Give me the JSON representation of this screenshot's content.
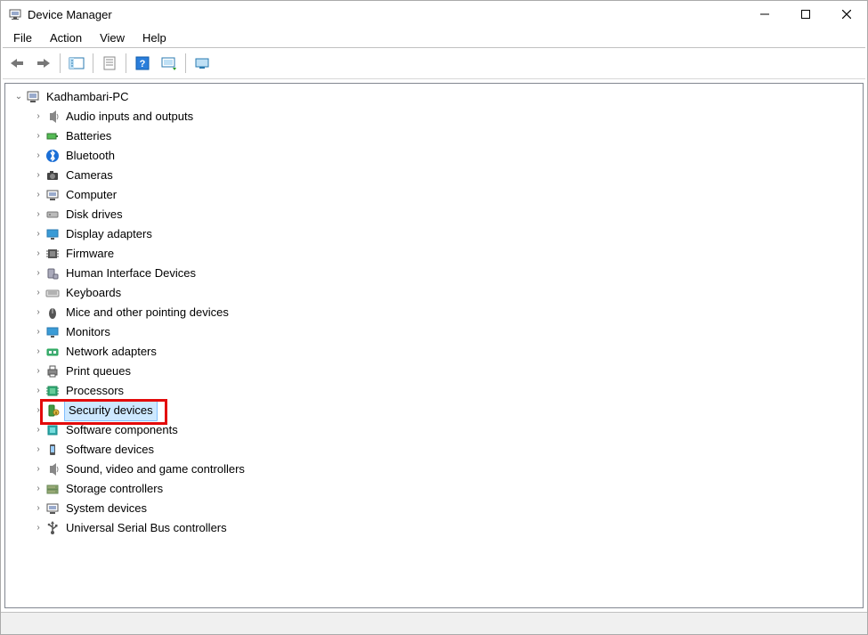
{
  "window": {
    "title": "Device Manager"
  },
  "menu": {
    "file": "File",
    "action": "Action",
    "view": "View",
    "help": "Help"
  },
  "tree": {
    "root": {
      "label": "Kadhambari-PC",
      "expanded": true
    },
    "items": [
      {
        "id": "audio",
        "label": "Audio inputs and outputs"
      },
      {
        "id": "batteries",
        "label": "Batteries"
      },
      {
        "id": "bluetooth",
        "label": "Bluetooth"
      },
      {
        "id": "cameras",
        "label": "Cameras"
      },
      {
        "id": "computer",
        "label": "Computer"
      },
      {
        "id": "diskdrives",
        "label": "Disk drives"
      },
      {
        "id": "display",
        "label": "Display adapters"
      },
      {
        "id": "firmware",
        "label": "Firmware"
      },
      {
        "id": "hid",
        "label": "Human Interface Devices"
      },
      {
        "id": "keyboards",
        "label": "Keyboards"
      },
      {
        "id": "mice",
        "label": "Mice and other pointing devices"
      },
      {
        "id": "monitors",
        "label": "Monitors"
      },
      {
        "id": "network",
        "label": "Network adapters"
      },
      {
        "id": "printq",
        "label": "Print queues"
      },
      {
        "id": "processors",
        "label": "Processors"
      },
      {
        "id": "security",
        "label": "Security devices",
        "selected": true,
        "highlight": true
      },
      {
        "id": "swcomp",
        "label": "Software components"
      },
      {
        "id": "swdev",
        "label": "Software devices"
      },
      {
        "id": "sound",
        "label": "Sound, video and game controllers"
      },
      {
        "id": "storage",
        "label": "Storage controllers"
      },
      {
        "id": "system",
        "label": "System devices"
      },
      {
        "id": "usb",
        "label": "Universal Serial Bus controllers"
      }
    ]
  }
}
